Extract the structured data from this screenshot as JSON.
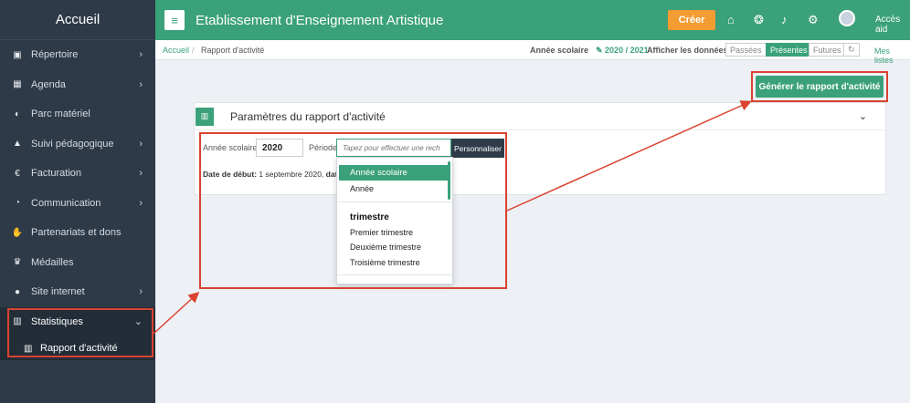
{
  "sidebar": {
    "header": "Accueil",
    "items": [
      {
        "label": "Répertoire",
        "icon": "address-book-icon",
        "chev": true
      },
      {
        "label": "Agenda",
        "icon": "calendar-icon",
        "chev": true
      },
      {
        "label": "Parc matériel",
        "icon": "gauge-icon",
        "chev": false
      },
      {
        "label": "Suivi pédagogique",
        "icon": "graduation-cap-icon",
        "chev": true
      },
      {
        "label": "Facturation",
        "icon": "euro-icon",
        "chev": true
      },
      {
        "label": "Communication",
        "icon": "comments-icon",
        "chev": true
      },
      {
        "label": "Partenariats et dons",
        "icon": "handshake-icon",
        "chev": false
      },
      {
        "label": "Médailles",
        "icon": "trophy-icon",
        "chev": false
      },
      {
        "label": "Site internet",
        "icon": "globe-icon",
        "chev": true
      },
      {
        "label": "Statistiques",
        "icon": "bar-chart-icon",
        "chev": true
      }
    ],
    "sub_item": "Rapport d'activité",
    "chevron_right": "›",
    "chevron_down": "⌄"
  },
  "topbar": {
    "title": "Etablissement d'Enseignement Artistique",
    "create_label": "Créer",
    "access_label": "Accès aid",
    "menu_glyph": "≡"
  },
  "breadcrumb": {
    "home": "Accueil",
    "separator": "/",
    "current": "Rapport d'activité",
    "school_year_label": "Année scolaire",
    "school_year_value": "2020 / 2021",
    "show_data_label": "Afficher les données :",
    "filters": [
      "Passées",
      "Présentes",
      "Futures"
    ],
    "active_filter": "Présentes",
    "my_lists": "Mes listes"
  },
  "generate_button": "Générer le rapport d'activité",
  "panel": {
    "title": "Paramètres du rapport d'activité",
    "year_label": "Année scolaire",
    "year_value": "2020",
    "period_label": "Période",
    "period_placeholder": "Tapez pour effectuer une rech",
    "customize_label": "Personnaliser",
    "start_date_label": "Date de début:",
    "start_date_value": "1 septembre 2020,",
    "end_fragment": "dat"
  },
  "dropdown": {
    "selected": "Année scolaire",
    "option_annee": "Année",
    "group_header": "trimestre",
    "options": [
      "Premier trimestre",
      "Deuxième trimestre",
      "Troisième trimestre"
    ]
  },
  "colors": {
    "accent": "#3aa17a",
    "sidebar": "#2e3a47",
    "highlight": "#d9432f",
    "create": "#f39c32"
  }
}
